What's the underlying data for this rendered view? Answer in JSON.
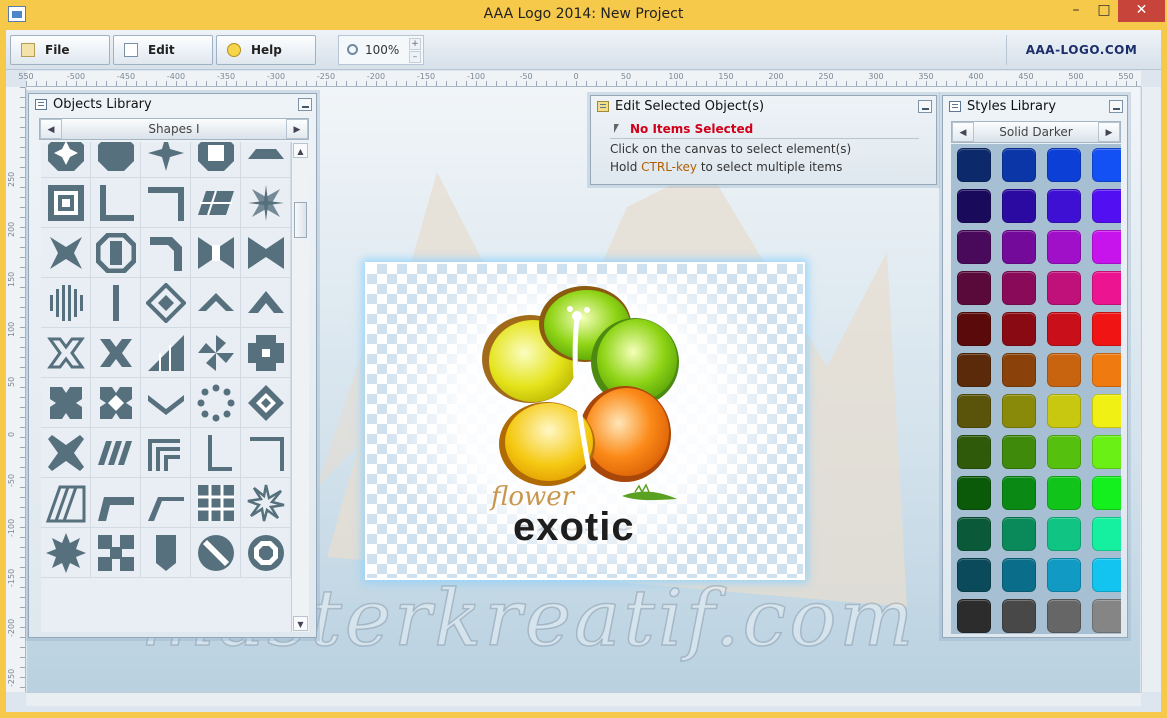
{
  "window": {
    "title": "AAA Logo 2014: New Project",
    "min_glyph": "–",
    "max_glyph": "□",
    "close_glyph": "✕"
  },
  "toolbar": {
    "file_label": "File",
    "edit_label": "Edit",
    "help_label": "Help",
    "zoom_value": "100%",
    "zoom_up": "+",
    "zoom_down": "–",
    "brand": "AAA-LOGO.COM"
  },
  "ruler": {
    "h_labels": [
      "550",
      "-500",
      "-450",
      "-400",
      "-350",
      "-300",
      "-250",
      "-200",
      "-150",
      "-100",
      "-50",
      "0",
      "50",
      "100",
      "150",
      "200",
      "250",
      "300",
      "350",
      "400",
      "450",
      "500",
      "550"
    ],
    "v_labels": [
      "250",
      "200",
      "150",
      "100",
      "50",
      "0",
      "-50",
      "-100",
      "-150",
      "-200",
      "-250"
    ]
  },
  "objects_library": {
    "title": "Objects Library",
    "category": "Shapes I",
    "prev_glyph": "◀",
    "next_glyph": "▶",
    "scroll_up_glyph": "▲",
    "scroll_down_glyph": "▼",
    "shape_color": "#56707e",
    "shapes": [
      "octagon-star",
      "octagon",
      "four-point-star",
      "octagon-ring",
      "trapezoid",
      "nested-squares",
      "corner-l",
      "corner-bracket",
      "parallelogram-tiles",
      "pinwheel",
      "star-bow",
      "knot-octagon",
      "hook-corner",
      "bowtie-open",
      "bowtie",
      "barcode-diamond",
      "vertical-bar",
      "diamond-arrow",
      "chevron-up-thin",
      "chevron-up",
      "x-mark-outline",
      "x-mark",
      "bars-ascending",
      "pinwheel-tiles",
      "cross-tiles",
      "cross-notched",
      "cross-diamond",
      "chevron-down",
      "dot-ring",
      "diamond-tiles",
      "cross-bold",
      "parallel-slants",
      "nested-corners",
      "thin-l",
      "right-angle",
      "striped-slant",
      "step-corner",
      "step-corner-outline",
      "grid-square",
      "starburst-ring",
      "gear-star",
      "cross-squares",
      "banner-pennant",
      "circle-slashed",
      "circle-octagon"
    ]
  },
  "edit_selected": {
    "title": "Edit Selected Object(s)",
    "status": "No Items Selected",
    "line1": "Click on the canvas to select element(s)",
    "line2_prefix": "Hold ",
    "line2_key": "CTRL-key",
    "line2_suffix": " to select multiple items"
  },
  "styles_library": {
    "title": "Styles Library",
    "category": "Solid Darker",
    "prev_glyph": "◀",
    "next_glyph": "▶",
    "swatch_rows": [
      [
        "#0c2a6b",
        "#0a36a8",
        "#0b3fd6",
        "#1451f5"
      ],
      [
        "#1a0a5c",
        "#2a0aa0",
        "#3d10d4",
        "#5210f2"
      ],
      [
        "#4a0a5c",
        "#740a9a",
        "#a010c8",
        "#c814ec"
      ],
      [
        "#5a0a3a",
        "#8a0a5a",
        "#c0107a",
        "#ec1490"
      ],
      [
        "#5a0a0a",
        "#8a0a14",
        "#c80f1a",
        "#f01414"
      ],
      [
        "#5a2a0a",
        "#8a420a",
        "#c86410",
        "#ee7a10"
      ],
      [
        "#5a540a",
        "#8a8a0a",
        "#c8c810",
        "#f0f014"
      ],
      [
        "#2e5a0a",
        "#3f8a0a",
        "#56c00f",
        "#6af014"
      ],
      [
        "#0a5a0a",
        "#0a8a14",
        "#10c41a",
        "#14f01e"
      ],
      [
        "#0a5a3a",
        "#0a8a5a",
        "#10c484",
        "#14f0a0"
      ],
      [
        "#0a4a5a",
        "#0a6e8a",
        "#109ac4",
        "#14c4f0"
      ],
      [
        "#2c2c2c",
        "#484848",
        "#666666",
        "#858585"
      ]
    ]
  },
  "canvas": {
    "logo_script_word": "flower",
    "logo_main_word": "exotic"
  },
  "watermark": "masterkreatif.com"
}
